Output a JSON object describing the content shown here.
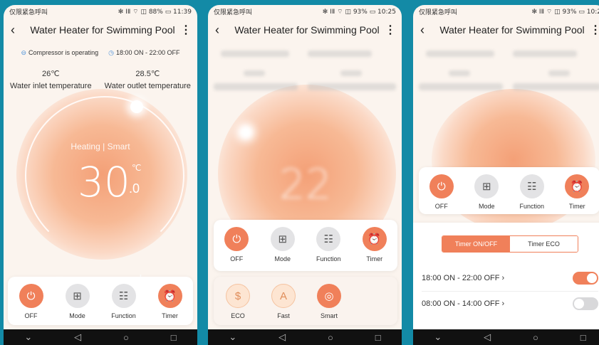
{
  "status": {
    "carrier": "仅限紧急呼叫",
    "right_1": "✻ ⅠⅡ ⌔ ◫ 88% ▭ 11:39",
    "right_2": "✻ ⅠⅡ ⌔ ◫ 93% ▭ 10:25",
    "right_3": "✻ ⅠⅡ ⌔ ◫ 93% ▭ 10:2"
  },
  "app": {
    "title": "Water Heater for Swimming Pool",
    "back_glyph": "‹",
    "more_glyph": "⋮"
  },
  "info": {
    "compressor": "Compressor is operating",
    "schedule": "18:00 ON - 22:00 OFF"
  },
  "temps": {
    "inlet_value": "26℃",
    "inlet_label": "Water inlet temperature",
    "outlet_value": "28.5℃",
    "outlet_label": "Water outlet temperature"
  },
  "dial": {
    "mode_text": "Heating | Smart",
    "temp_1": "30",
    "decimal_1": ".0",
    "unit": "℃",
    "temp_2": "22",
    "mode_text_2": "Heating | Smart",
    "minus": "−",
    "plus": "+"
  },
  "bottom_buttons": [
    {
      "label": "OFF",
      "glyph": "⏻"
    },
    {
      "label": "Mode",
      "glyph": "⊞"
    },
    {
      "label": "Function",
      "glyph": "☷"
    },
    {
      "label": "Timer",
      "glyph": "⏰"
    }
  ],
  "function_options": [
    {
      "label": "ECO",
      "glyph": "$"
    },
    {
      "label": "Fast",
      "glyph": "A"
    },
    {
      "label": "Smart",
      "glyph": "◎"
    }
  ],
  "timer": {
    "tab_active": "Timer ON/OFF",
    "tab_inactive": "Timer ECO",
    "rows": [
      {
        "text": "18:00 ON - 22:00 OFF",
        "chevron": "›",
        "enabled": true
      },
      {
        "text": "08:00 ON - 14:00 OFF",
        "chevron": "›",
        "enabled": false
      }
    ]
  },
  "nav": {
    "back": "◁",
    "home": "○",
    "recent": "□",
    "down": "⌄"
  }
}
